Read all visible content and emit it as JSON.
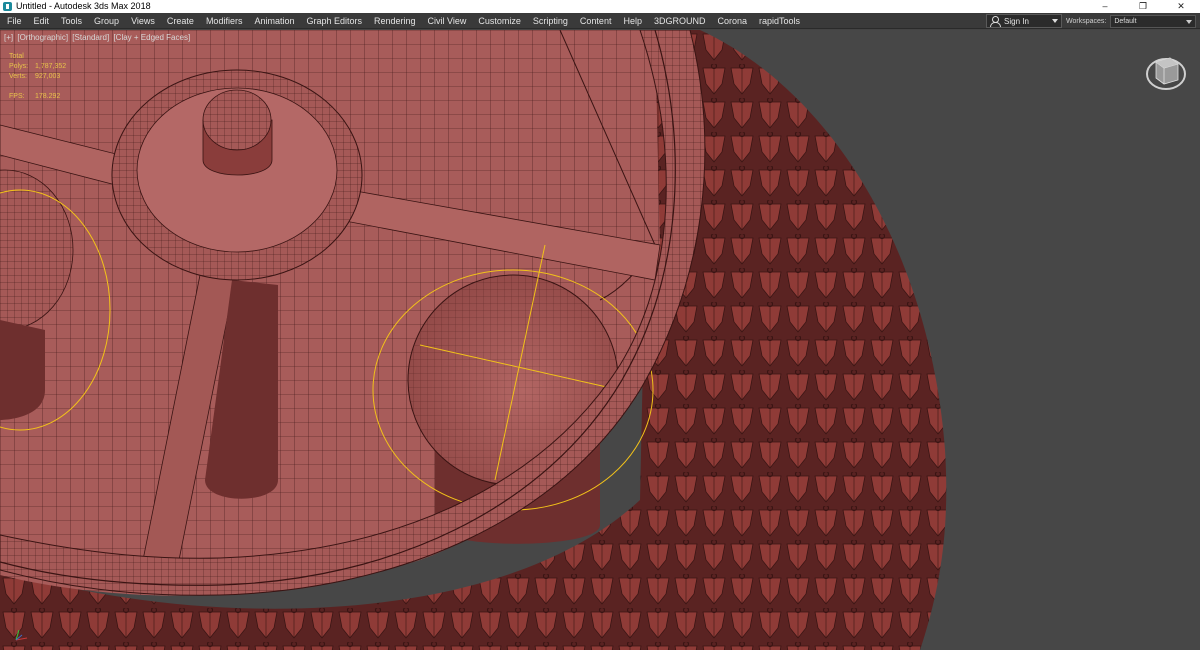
{
  "window": {
    "title": "Untitled - Autodesk 3ds Max 2018",
    "controls": {
      "minimize": "–",
      "restore": "❐",
      "close": "✕"
    }
  },
  "menu": {
    "items": [
      "File",
      "Edit",
      "Tools",
      "Group",
      "Views",
      "Create",
      "Modifiers",
      "Animation",
      "Graph Editors",
      "Rendering",
      "Civil View",
      "Customize",
      "Scripting",
      "Content",
      "Help",
      "3DGROUND",
      "Corona",
      "rapidTools"
    ],
    "sign_in": "Sign In",
    "workspaces_label": "Workspaces:",
    "workspaces_value": "Default"
  },
  "viewport": {
    "labels": [
      "[+]",
      "[Orthographic]",
      "[Standard]",
      "[Clay + Edged Faces]"
    ],
    "stats": {
      "total_label": "Total",
      "polys_label": "Polys:",
      "polys_value": "1,787,352",
      "verts_label": "Verts:",
      "verts_value": "927,003",
      "fps_label": "FPS:",
      "fps_value": "178.292"
    }
  },
  "colors": {
    "clay": "#a85c5a",
    "clay_dark": "#6e2f2e",
    "wire": "#3a1413",
    "selection": "#f2c21a",
    "background": "#474747"
  },
  "icons": {
    "app": "3ds-max-icon",
    "user": "user-icon",
    "viewcube": "viewcube-icon",
    "axis": "axis-tripod-icon"
  }
}
